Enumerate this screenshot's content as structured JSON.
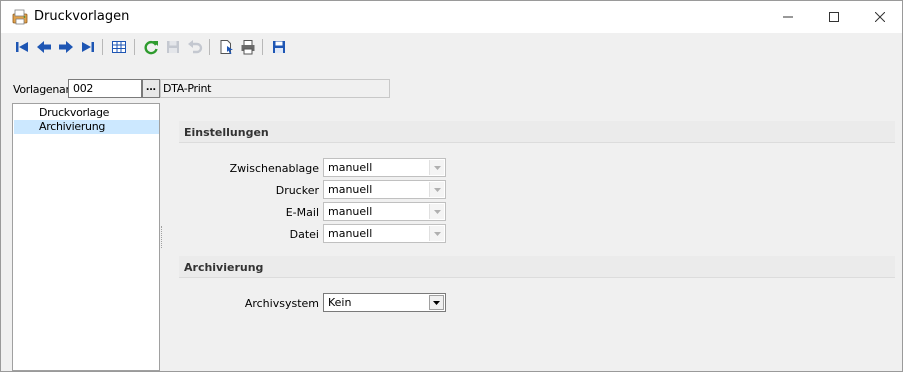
{
  "window": {
    "title": "Druckvorlagen",
    "controls": {
      "minimize_icon": "minimize-icon",
      "maximize_icon": "maximize-icon",
      "close_icon": "close-icon"
    }
  },
  "toolbar": {
    "buttons": [
      {
        "name": "first-record-icon"
      },
      {
        "name": "previous-record-icon"
      },
      {
        "name": "next-record-icon"
      },
      {
        "name": "last-record-icon"
      },
      {
        "name": "table-view-icon"
      },
      {
        "name": "refresh-icon"
      },
      {
        "name": "save-icon",
        "disabled": true
      },
      {
        "name": "undo-icon",
        "disabled": true
      },
      {
        "name": "new-document-icon"
      },
      {
        "name": "print-icon"
      },
      {
        "name": "save-layout-icon"
      }
    ]
  },
  "header": {
    "vorlagenart_label": "Vorlagenart",
    "vorlagenart_value": "002",
    "browse_label": "...",
    "description": "DTA-Print"
  },
  "tree": {
    "items": [
      {
        "label": "Druckvorlage",
        "selected": false
      },
      {
        "label": "Archivierung",
        "selected": true
      }
    ]
  },
  "settings": {
    "section1_title": "Einstellungen",
    "fields": [
      {
        "label": "Zwischenablage",
        "value": "manuell"
      },
      {
        "label": "Drucker",
        "value": "manuell"
      },
      {
        "label": "E-Mail",
        "value": "manuell"
      },
      {
        "label": "Datei",
        "value": "manuell"
      }
    ],
    "section2_title": "Archivierung",
    "archiv_label": "Archivsystem",
    "archiv_value": "Kein"
  },
  "colors": {
    "selection": "#cce8ff",
    "section_bg": "#ebebeb",
    "toolbar_blue": "#1e56b4",
    "refresh_green": "#2e9b2e"
  }
}
